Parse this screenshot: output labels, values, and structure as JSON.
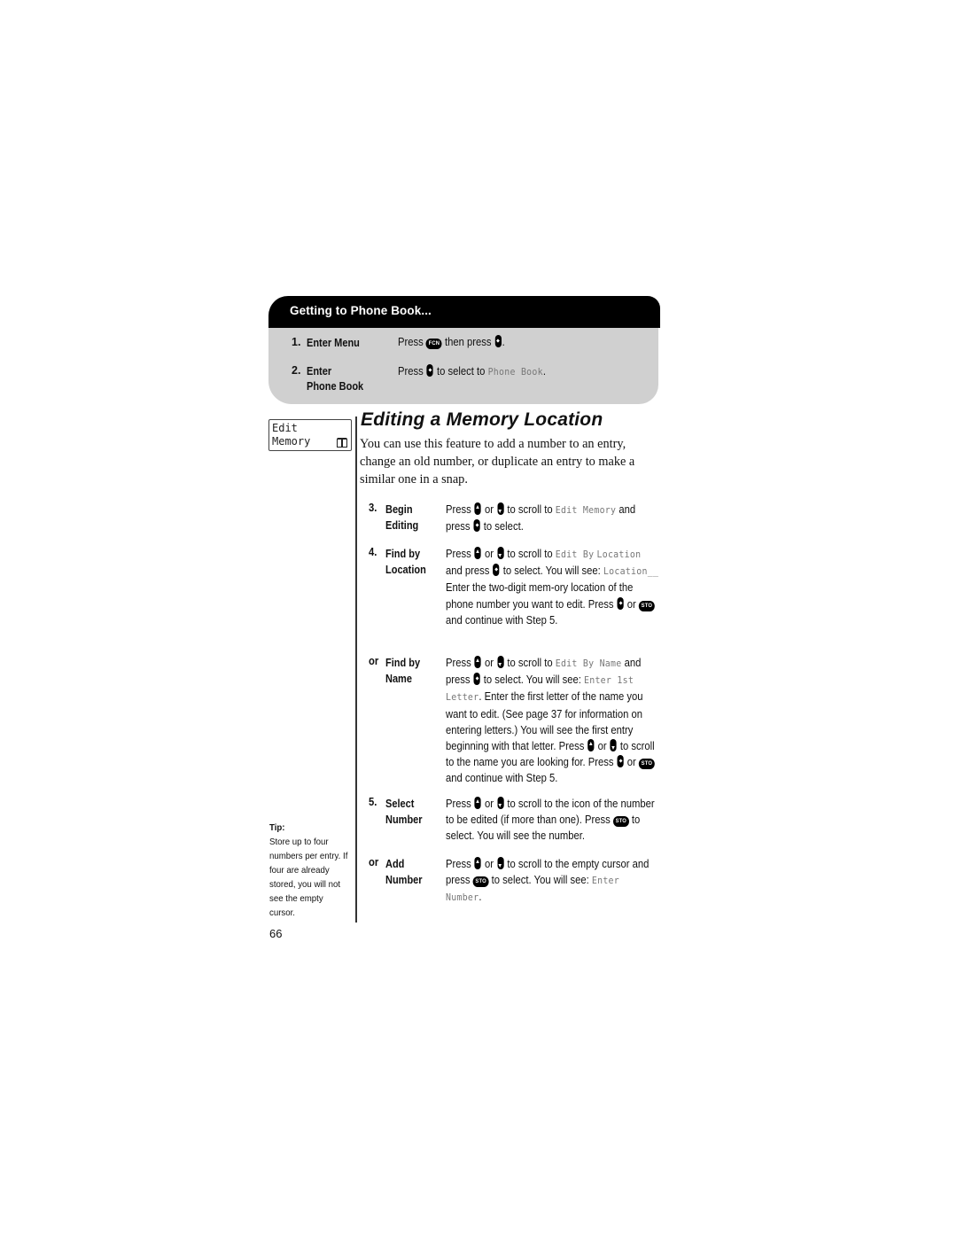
{
  "panel": {
    "title": "Getting to Phone Book...",
    "steps": [
      {
        "num": "1.",
        "label": "Enter Menu",
        "text_before": "Press",
        "key1": "FCN",
        "text_mid": "then press",
        "text_after": "."
      },
      {
        "num": "2.",
        "label_line1": "Enter",
        "label_line2": "Phone Book",
        "text_before": "Press",
        "text_mid": "to select to",
        "lcd": "Phone Book",
        "text_after": "."
      }
    ]
  },
  "display": {
    "line1": "Edit",
    "line2": "Memory",
    "icon": "phone-book-icon"
  },
  "section": {
    "title": "Editing a Memory Location",
    "intro": "You can use this feature to add a number to an entry, change an old number, or duplicate an entry to make a similar one in a snap."
  },
  "keys": {
    "fcn": "FCN",
    "sto": "STO"
  },
  "words": {
    "press": "Press",
    "press_lc": "press",
    "or": "or",
    "to_select": "to select.",
    "to_scroll_to": "to scroll to",
    "and": "and",
    "and_press": "and press"
  },
  "steps": [
    {
      "num": "3.",
      "label_line1": "Begin",
      "label_line2": "Editing",
      "lcd1": "Edit Memory"
    },
    {
      "num": "4.",
      "label_line1": "Find by",
      "label_line2": "Location",
      "lcd1": "Edit By",
      "lcd2": "Location",
      "lcd3": "Location__",
      "t1": "to select. You will see:",
      "t2": "Enter the two-digit mem-ory location of the phone number you want to edit. Press",
      "t3": "and continue with Step 5."
    },
    {
      "num": "or",
      "label_line1": "Find by",
      "label_line2": "Name",
      "lcd1": "Edit By Name",
      "lcd2": "Enter 1st Letter",
      "t1": "to select. You will see:",
      "t2": ". Enter the first letter of the name you want to edit. (See page 37 for information on entering letters.) You will see the first entry beginning with that letter. Press",
      "t3": "to scroll to the name you are looking for. Press",
      "t4": "and continue with Step 5."
    },
    {
      "num": "5.",
      "label_line1": "Select",
      "label_line2": "Number",
      "t1": "to scroll to the icon of the number to be edited (if more than one). Press",
      "t2": "to select. You will see the number."
    },
    {
      "num": "or",
      "label_line1": "Add",
      "label_line2": "Number",
      "t1": "to scroll to the empty cursor and press",
      "t2": "to select. You will see:",
      "lcd1": "Enter Number",
      "t3": "."
    }
  ],
  "tip": {
    "heading": "Tip:",
    "text": "Store up to four numbers per entry. If four are already stored, you will not see the empty cursor."
  },
  "page_number": "66"
}
